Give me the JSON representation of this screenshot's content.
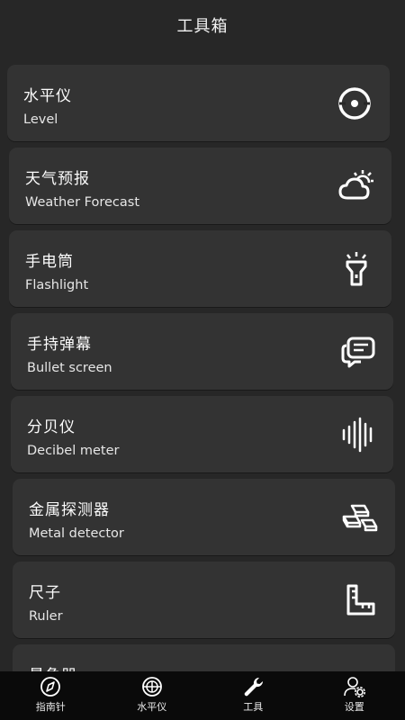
{
  "header": {
    "title": "工具箱"
  },
  "tools": [
    {
      "title": "水平仪",
      "subtitle": "Level",
      "icon": "level-icon"
    },
    {
      "title": "天气预报",
      "subtitle": "Weather Forecast",
      "icon": "weather-icon"
    },
    {
      "title": "手电筒",
      "subtitle": "Flashlight",
      "icon": "flashlight-icon"
    },
    {
      "title": "手持弹幕",
      "subtitle": "Bullet screen",
      "icon": "chat-icon"
    },
    {
      "title": "分贝仪",
      "subtitle": "Decibel meter",
      "icon": "soundwave-icon"
    },
    {
      "title": "金属探测器",
      "subtitle": "Metal detector",
      "icon": "metal-bars-icon"
    },
    {
      "title": "尺子",
      "subtitle": "Ruler",
      "icon": "ruler-icon"
    },
    {
      "title": "量角器",
      "subtitle": "",
      "icon": ""
    }
  ],
  "tabbar": {
    "items": [
      {
        "label": "指南针",
        "icon": "compass-icon"
      },
      {
        "label": "水平仪",
        "icon": "level-tab-icon"
      },
      {
        "label": "工具",
        "icon": "wrench-icon",
        "active": true
      },
      {
        "label": "设置",
        "icon": "settings-user-icon"
      }
    ]
  },
  "colors": {
    "background": "#272727",
    "card": "#333333",
    "tabbar": "#0a0a0a",
    "text": "#ffffff"
  }
}
